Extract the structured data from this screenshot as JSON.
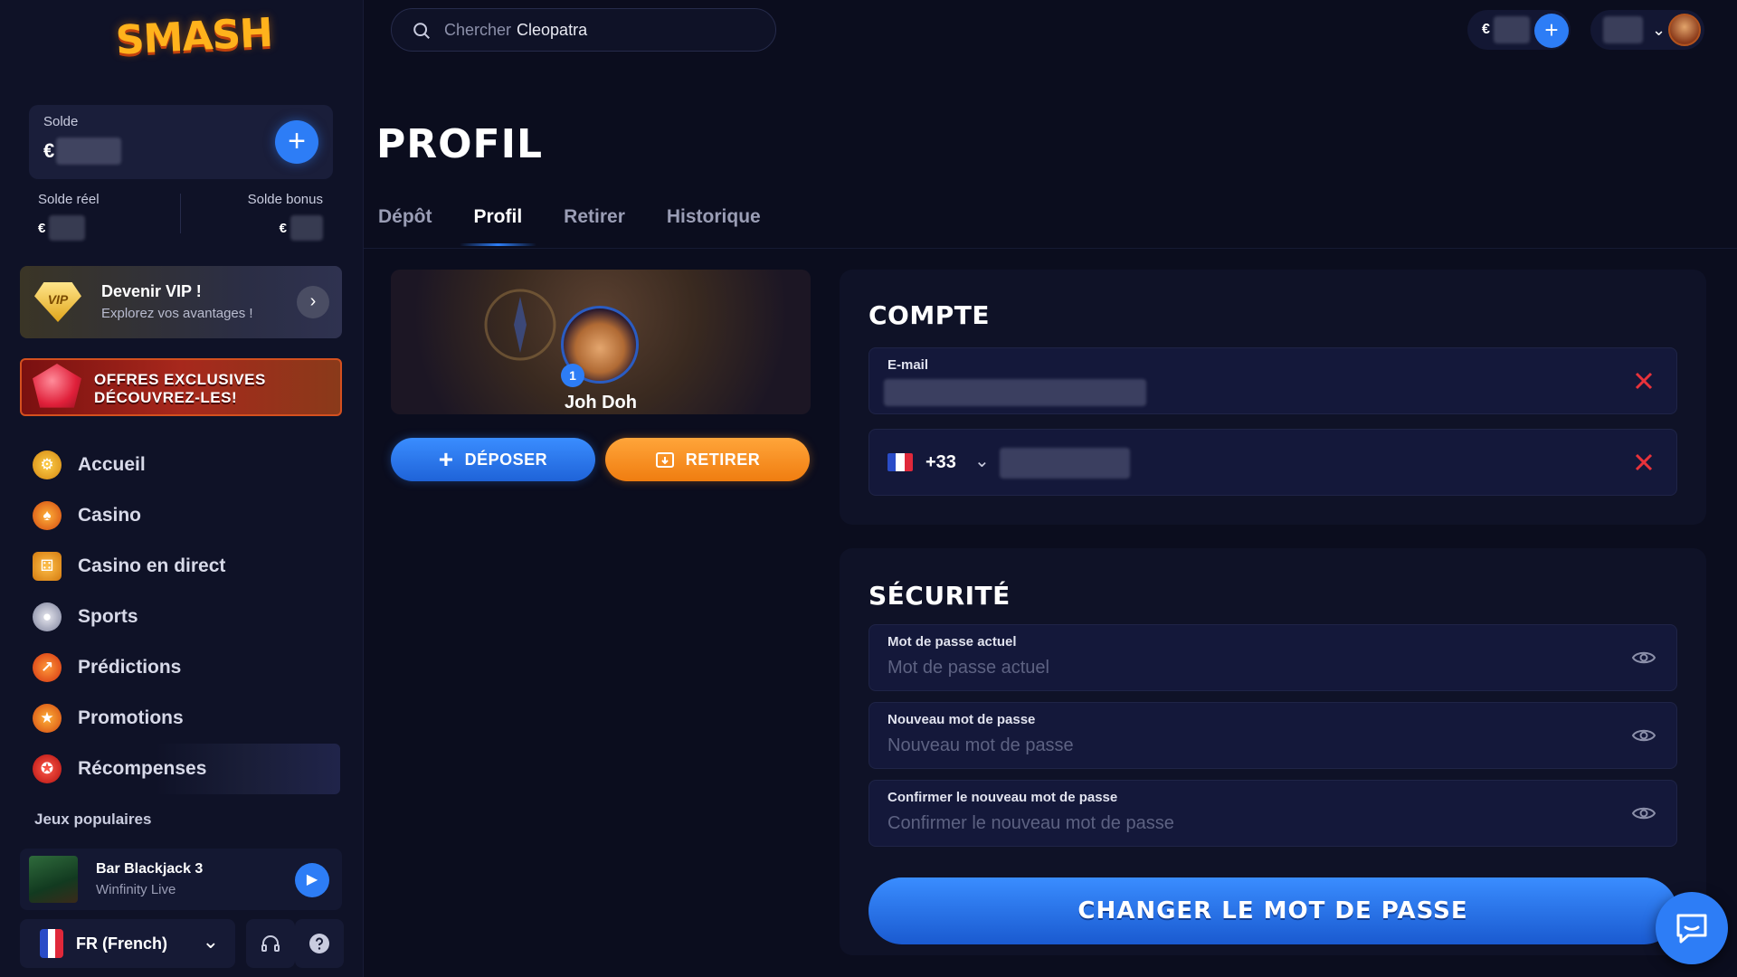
{
  "brand": {
    "logo_text": "SMASH"
  },
  "search": {
    "placeholder": "Chercher",
    "value": "Cleopatra"
  },
  "topbar": {
    "currency": "€"
  },
  "sidebar": {
    "balance_label": "Solde",
    "currency": "€",
    "real_balance_label": "Solde réel",
    "bonus_balance_label": "Solde bonus",
    "vip": {
      "badge": "VIP",
      "title": "Devenir VIP !",
      "subtitle": "Explorez vos avantages !"
    },
    "promo": {
      "line1": "OFFRES EXCLUSIVES",
      "line2": "DÉCOUVREZ-LES!"
    },
    "nav": [
      {
        "label": "Accueil",
        "icon": "home-icon"
      },
      {
        "label": "Casino",
        "icon": "spade-icon"
      },
      {
        "label": "Casino en direct",
        "icon": "dice-icon"
      },
      {
        "label": "Sports",
        "icon": "soccer-ball-icon"
      },
      {
        "label": "Prédictions",
        "icon": "trend-icon"
      },
      {
        "label": "Promotions",
        "icon": "promo-icon"
      },
      {
        "label": "Récompenses",
        "icon": "medal-icon"
      }
    ],
    "popular_title": "Jeux populaires",
    "popular_game": {
      "name": "Bar Blackjack 3",
      "provider": "Winfinity Live"
    },
    "language": "FR (French)"
  },
  "page": {
    "title": "PROFIL",
    "tabs": [
      {
        "label": "Dépôt",
        "active": false
      },
      {
        "label": "Profil",
        "active": true
      },
      {
        "label": "Retirer",
        "active": false
      },
      {
        "label": "Historique",
        "active": false
      }
    ]
  },
  "profile": {
    "name": "Joh Doh",
    "level": "1",
    "deposit_label": "DÉPOSER",
    "withdraw_label": "RETIRER"
  },
  "account": {
    "title": "COMPTE",
    "email_label": "E-mail",
    "phone_code": "+33"
  },
  "security": {
    "title": "SÉCURITÉ",
    "current_label": "Mot de passe actuel",
    "current_placeholder": "Mot de passe actuel",
    "new_label": "Nouveau mot de passe",
    "new_placeholder": "Nouveau mot de passe",
    "confirm_label": "Confirmer le nouveau mot de passe",
    "confirm_placeholder": "Confirmer le nouveau mot de passe",
    "submit_label": "CHANGER LE MOT DE PASSE"
  },
  "colors": {
    "accent": "#2d7df6",
    "withdraw": "#f58a1f",
    "danger": "#e8323a",
    "background": "#0b0d1e"
  }
}
